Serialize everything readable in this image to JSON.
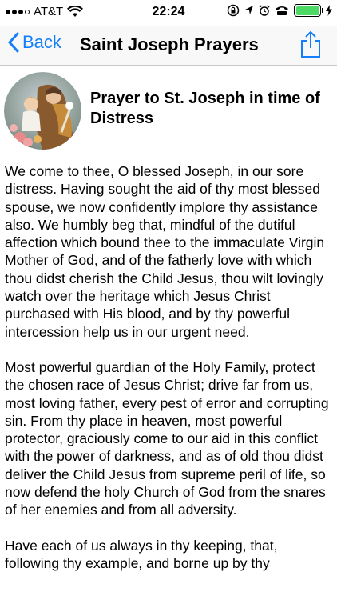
{
  "status_bar": {
    "carrier": "AT&T",
    "time": "22:24",
    "icons": [
      "signal-icon",
      "wifi-icon",
      "screen-lock-icon",
      "location-icon",
      "alarm-icon",
      "tty-icon",
      "battery-icon",
      "charging-icon"
    ],
    "battery_level": 1.0,
    "battery_color": "#4cd964"
  },
  "nav": {
    "back_label": "Back",
    "title": "Saint Joseph Prayers",
    "share_icon": "share-icon",
    "accent_color": "#147efb"
  },
  "prayer": {
    "title": "Prayer to St. Joseph in time of Distress",
    "paragraphs": [
      "We come to thee, O blessed Joseph, in our sore distress. Having sought the aid of thy most blessed spouse, we now confidently implore thy assistance also. We humbly beg that, mindful of the dutiful affection which bound thee to the immaculate Virgin Mother of God, and of the fatherly love with which thou didst cherish the Child Jesus, thou wilt lovingly watch over the heritage which Jesus Christ purchased with His blood, and by thy powerful intercession help us in our urgent need.",
      "Most powerful guardian of the Holy Family, protect the chosen race of Jesus Christ; drive far from us, most loving father, every pest of error and corrupting sin. From thy place in heaven, most powerful protector, graciously come to our aid in this conflict with the power of darkness, and as of old thou didst deliver the Child Jesus from supreme peril of life, so now defend the holy Church of God from the snares of her enemies and from all adversity.",
      "Have each of us always in thy keeping, that, following thy example, and borne up by thy"
    ]
  }
}
